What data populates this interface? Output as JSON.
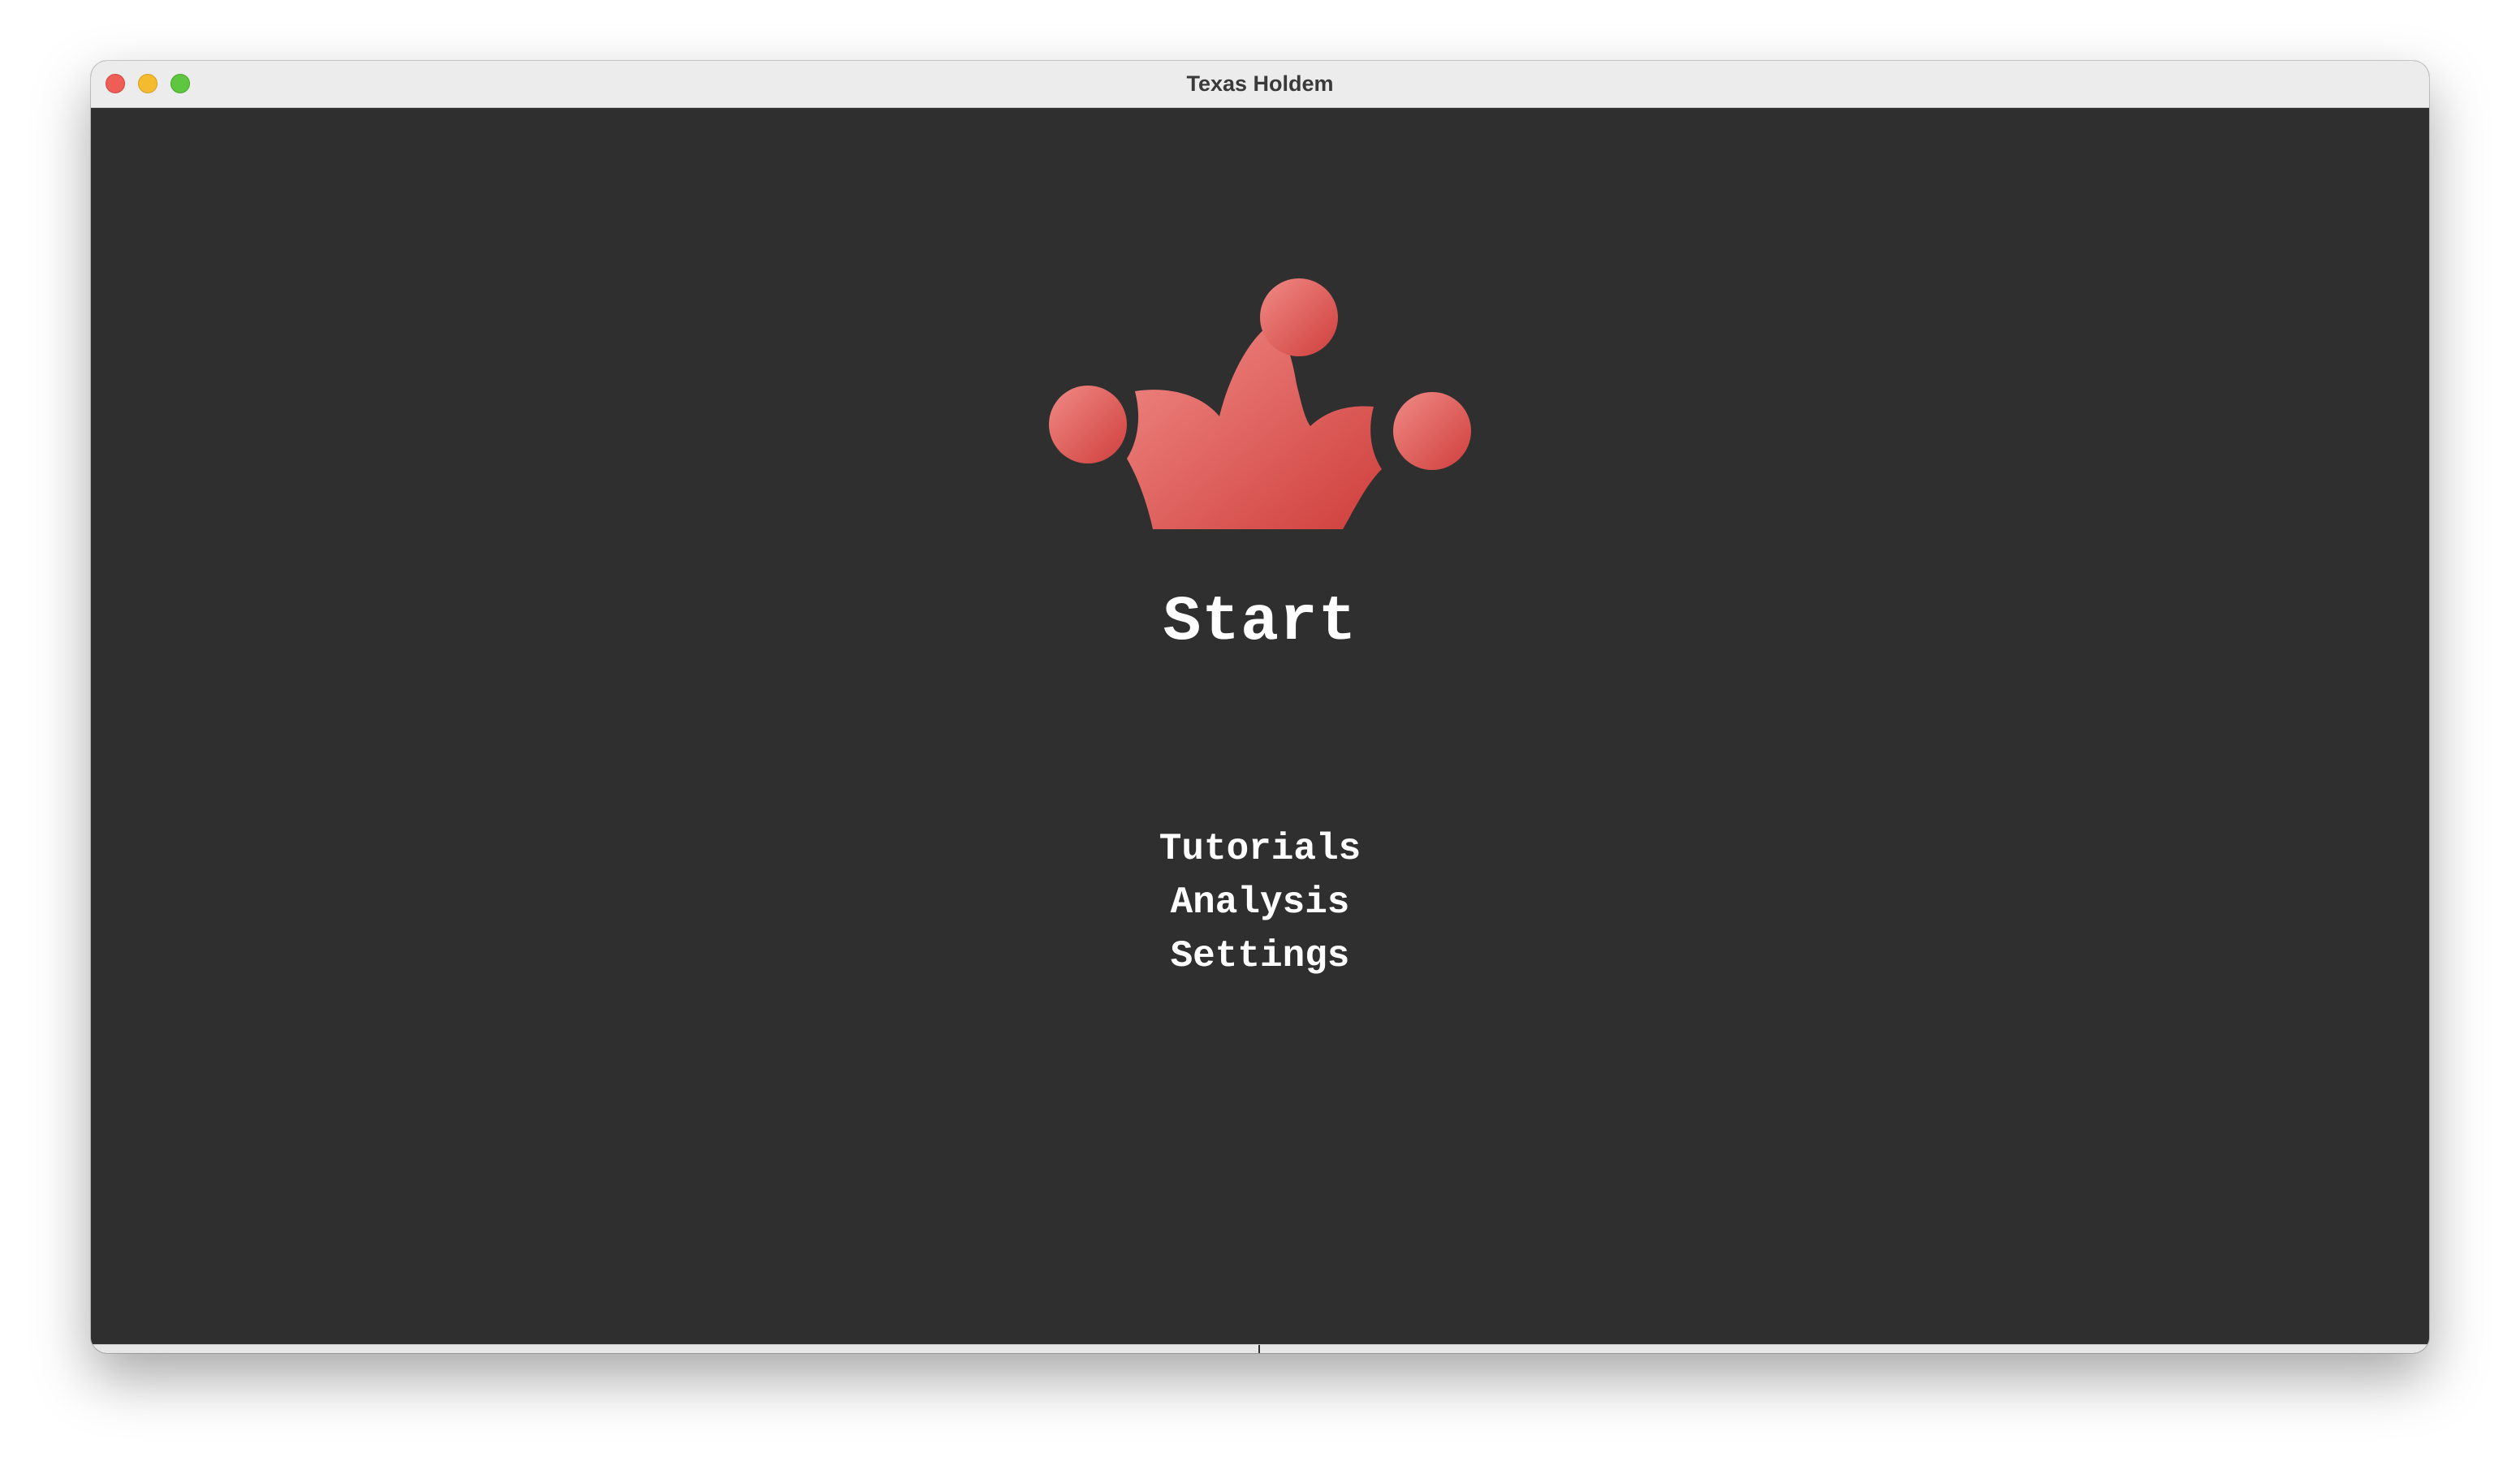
{
  "window": {
    "title": "Texas Holdem"
  },
  "logo": {
    "icon": "crown-icon",
    "gradient_start": "#f08a86",
    "gradient_end": "#cf3f3c"
  },
  "main": {
    "start_label": "Start",
    "menu_items": [
      {
        "label": "Tutorials"
      },
      {
        "label": "Analysis"
      },
      {
        "label": "Settings"
      }
    ]
  },
  "colors": {
    "background": "#2f2f2f",
    "text": "#ffffff",
    "titlebar": "#ececec"
  }
}
